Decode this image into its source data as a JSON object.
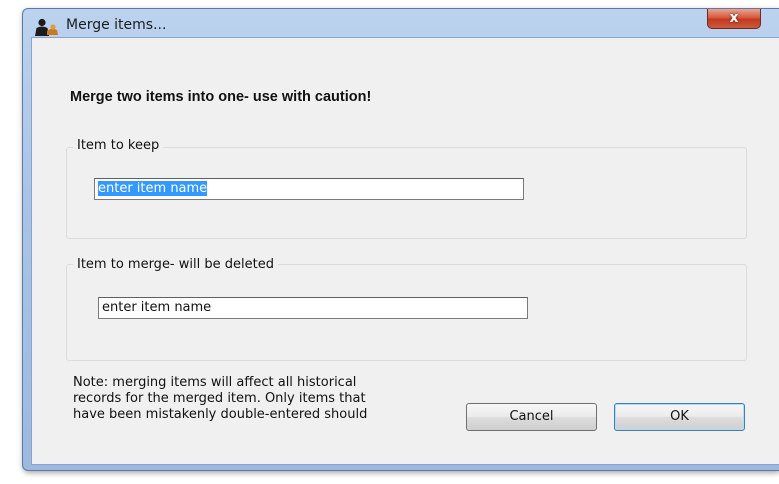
{
  "window": {
    "title": "Merge items...",
    "close_symbol": "x",
    "app_icon": "user-silhouette-icon"
  },
  "dialog": {
    "heading": "Merge two items into one- use with caution!",
    "keep_group": {
      "label": "Item to keep",
      "input_value": "enter item name"
    },
    "merge_group": {
      "label": "Item to merge- will be deleted",
      "input_value": "enter item name"
    },
    "note_lines": [
      "Note: merging items will affect all historical",
      "records for the merged item. Only items that",
      "have been mistakenly double-entered should"
    ],
    "cancel_label": "Cancel",
    "ok_label": "OK"
  },
  "colors": {
    "selection": "#3399ff",
    "title_bar": "#a9c4e8",
    "close_button": "#c13a20"
  }
}
